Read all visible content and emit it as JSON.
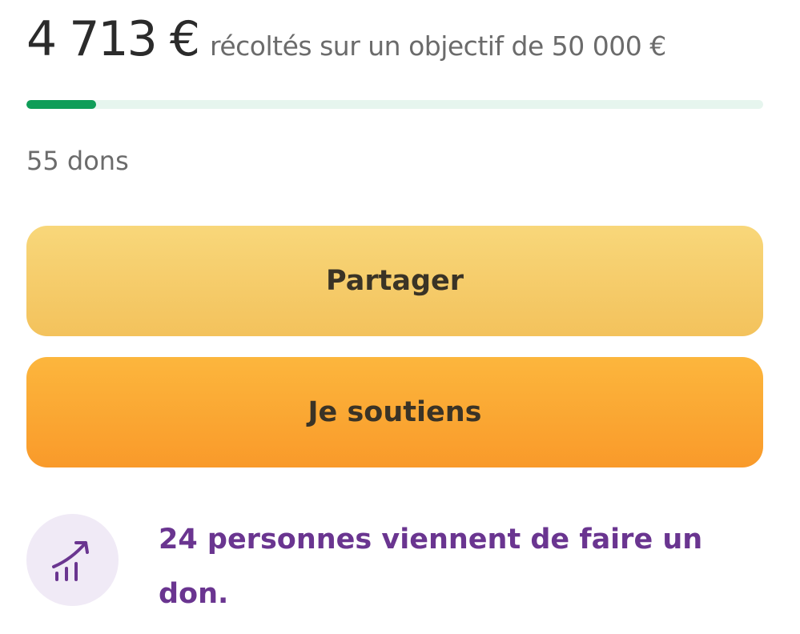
{
  "campaign": {
    "amount_raised": "4 713 €",
    "goal_text": "récoltés sur un objectif de 50 000 €",
    "progress_fraction": 0.0943,
    "donations_label": "55 dons"
  },
  "actions": {
    "share_label": "Partager",
    "support_label": "Je soutiens"
  },
  "notice": {
    "icon": "trending-up-chart-icon",
    "text": "24 personnes viennent de faire un don."
  },
  "colors": {
    "progress_fill": "#0f9d58",
    "progress_track": "#e6f5ee",
    "share_button": "#f5cb66",
    "support_button": "#fbaa34",
    "notice_text": "#6a3590",
    "notice_icon_bg": "#f0eaf6"
  }
}
